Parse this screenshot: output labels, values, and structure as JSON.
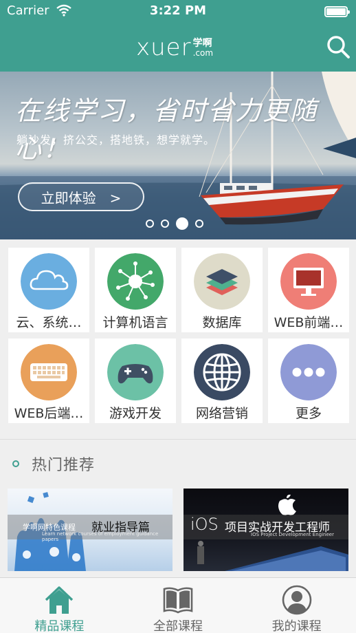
{
  "status": {
    "carrier": "Carrier",
    "time": "3:22 PM"
  },
  "nav": {
    "logo_main": "xuer",
    "logo_cn": "学啊",
    "logo_com": ".com",
    "search_icon": "search-icon"
  },
  "banner": {
    "title": "在线学习，省时省力更随心！",
    "subtitle": "躺沙发，挤公交，搭地铁，想学就学。",
    "button": "立即体验　>",
    "page_count": 4,
    "active_page": 3
  },
  "categories": [
    {
      "label": "云、系统…",
      "icon": "cloud-icon",
      "color": "#6aaee0"
    },
    {
      "label": "计算机语言",
      "icon": "network-node-icon",
      "color": "#43a86a"
    },
    {
      "label": "数据库",
      "icon": "database-layers-icon",
      "color": "#dedbc9"
    },
    {
      "label": "WEB前端…",
      "icon": "monitor-icon",
      "color": "#ef7e76"
    },
    {
      "label": "WEB后端…",
      "icon": "keyboard-icon",
      "color": "#e9a05a"
    },
    {
      "label": "游戏开发",
      "icon": "gamepad-icon",
      "color": "#6cc1a6"
    },
    {
      "label": "网络营销",
      "icon": "globe-icon",
      "color": "#3a4a63"
    },
    {
      "label": "更多",
      "icon": "more-dots-icon",
      "color": "#8f9ad6"
    }
  ],
  "hot": {
    "title": "热门推荐",
    "cards": [
      {
        "title": "就业指导篇",
        "caption": "学啊网特色课程",
        "fine": "Learn network courses of employment guidance papers"
      },
      {
        "brand": "iOS",
        "title": "项目实战开发工程师",
        "fine": "IOS Project Development Engineer"
      }
    ]
  },
  "tabs": [
    {
      "label": "精品课程",
      "icon": "home-icon",
      "active": true
    },
    {
      "label": "全部课程",
      "icon": "book-icon",
      "active": false
    },
    {
      "label": "我的课程",
      "icon": "user-avatar-icon",
      "active": false
    }
  ]
}
